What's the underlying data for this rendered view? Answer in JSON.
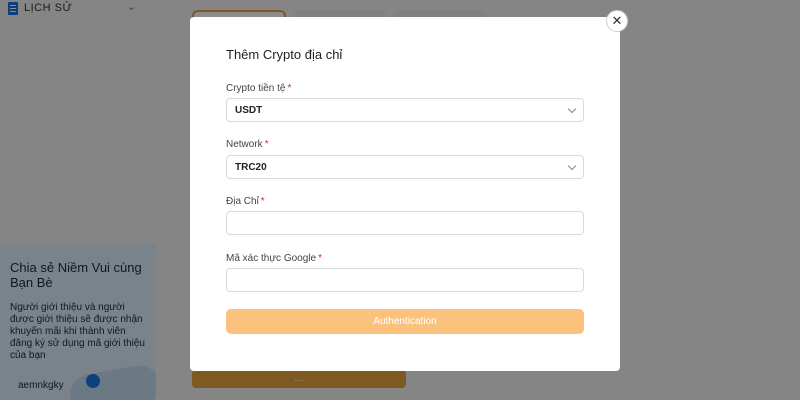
{
  "background": {
    "sidebar": {
      "history_label": "LỊCH SỬ"
    },
    "share": {
      "title": "Chia sẻ Niềm Vui cùng Bạn Bè",
      "description": "Người giới thiệu và người được giới thiệu sẽ được nhận khuyến mãi khi thành viên đăng ký sử dụng mã giới thiệu của bạn",
      "referral_code": "aemnkgky"
    },
    "bottom_button_label": "..."
  },
  "modal": {
    "title": "Thêm Crypto địa chỉ",
    "close_glyph": "✕",
    "required_mark": "*",
    "currency": {
      "label": "Crypto tiền tệ",
      "value": "USDT"
    },
    "network": {
      "label": "Network",
      "value": "TRC20"
    },
    "address": {
      "label": "Địa Chỉ",
      "value": "",
      "placeholder": ""
    },
    "google_code": {
      "label": "Mã xác thực Google",
      "value": "",
      "placeholder": ""
    },
    "submit_label": "Authentication"
  },
  "colors": {
    "accent": "#fbc27e",
    "required": "#d6263b",
    "overlay": "rgba(0,0,0,0.45)"
  }
}
